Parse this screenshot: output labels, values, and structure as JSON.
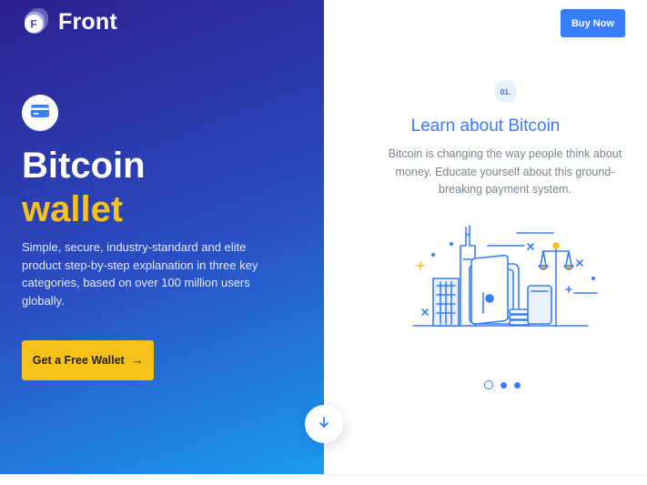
{
  "brand": {
    "name": "Front",
    "logo_letter": "F"
  },
  "header": {
    "buy_label": "Buy Now"
  },
  "hero": {
    "title_line1": "Bitcoin",
    "title_line2": "wallet",
    "description": "Simple, secure, industry-standard and elite product step-by-step explanation in three key categories, based on over 100 million users globally.",
    "cta_label": "Get a Free Wallet",
    "cta_arrow": "→"
  },
  "slider": {
    "step": "01.",
    "title": "Learn about Bitcoin",
    "text": "Bitcoin is changing the way people think about money. Educate yourself about this ground-breaking payment system.",
    "active_index": 0,
    "total_slides": 3
  },
  "colors": {
    "gradient_start": "#2d1f8f",
    "gradient_end": "#1a9cf2",
    "accent_yellow": "#f7c11b",
    "primary_blue": "#377dff",
    "muted_text": "#77838f"
  },
  "icons": {
    "card": "credit-card-icon",
    "cta_arrow": "arrow-right-icon",
    "scroll": "arrow-down-icon"
  }
}
